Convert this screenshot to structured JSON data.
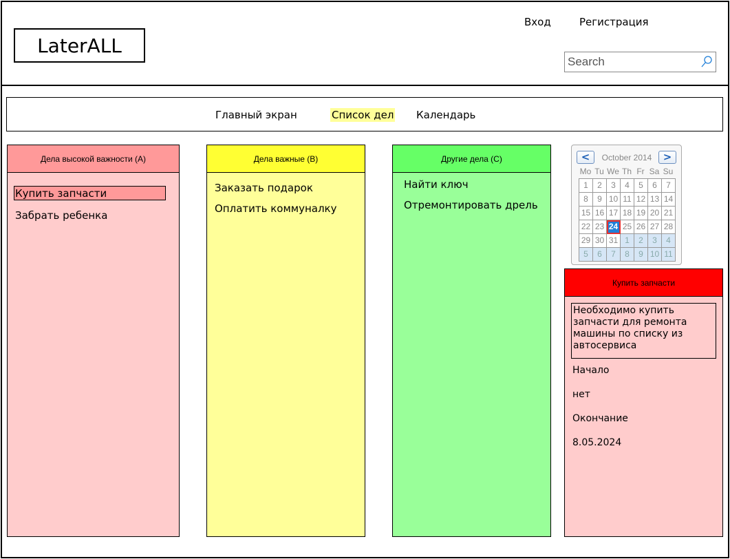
{
  "app": {
    "logo": "LaterALL"
  },
  "auth": {
    "login": "Вход",
    "register": "Регистрация"
  },
  "search": {
    "placeholder": "Search"
  },
  "nav": {
    "main": "Главный экран",
    "todo": "Список дел",
    "calendar": "Календарь",
    "active": "todo"
  },
  "columns": [
    {
      "title": "Дела высокой важности (A)",
      "color": "#ff9999",
      "body_color": "#ffcccc",
      "tasks": [
        "Купить запчасти",
        "Забрать ребенка"
      ],
      "selected": 0
    },
    {
      "title": "Дела важные (B)",
      "color": "#ffff33",
      "body_color": "#ffff99",
      "tasks": [
        "Заказать подарок",
        "Оплатить коммуналку"
      ]
    },
    {
      "title": "Другие дела (C)",
      "color": "#66ff66",
      "body_color": "#99ff99",
      "tasks": [
        "Найти ключ",
        "Отремонтировать дрель"
      ]
    }
  ],
  "calendar": {
    "prev": "<",
    "next": ">",
    "month_label": "October 2014",
    "weekdays": [
      "Mo",
      "Tu",
      "We",
      "Th",
      "Fr",
      "Sa",
      "Su"
    ],
    "weeks": [
      [
        "1",
        "2",
        "3",
        "4",
        "5",
        "6",
        "7"
      ],
      [
        "8",
        "9",
        "10",
        "11",
        "12",
        "13",
        "14"
      ],
      [
        "15",
        "16",
        "17",
        "18",
        "19",
        "20",
        "21"
      ],
      [
        "22",
        "23",
        "24",
        "25",
        "26",
        "27",
        "28"
      ],
      [
        "29",
        "30",
        "31",
        "1",
        "2",
        "3",
        "4"
      ],
      [
        "5",
        "6",
        "7",
        "8",
        "9",
        "10",
        "11"
      ]
    ],
    "selected_day": "24"
  },
  "detail": {
    "title": "Купить запчасти",
    "header_color": "#ff0000",
    "description": "Необходимо купить запчасти для ремонта машины по списку из автосервиса",
    "start_label": "Начало",
    "start_value": "нет",
    "end_label": "Окончание",
    "end_value": "8.05.2024"
  }
}
